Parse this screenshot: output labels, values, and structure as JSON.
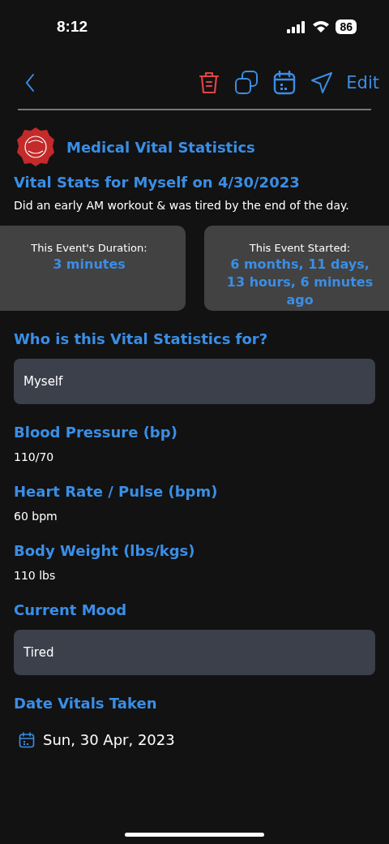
{
  "status_bar": {
    "time": "8:12",
    "battery": "86"
  },
  "toolbar": {
    "edit": "Edit"
  },
  "header": {
    "category": "Medical Vital Statistics",
    "title": "Vital Stats for Myself on 4/30/2023",
    "note": "Did an early AM workout & was tired by the end of the day."
  },
  "cards": [
    {
      "label": "This Event's Duration:",
      "value": "3 minutes"
    },
    {
      "label": "This Event Started:",
      "value": "6 months, 11 days, 13 hours, 6 minutes ago"
    }
  ],
  "fields": [
    {
      "kind": "box",
      "label": "Who is this Vital Statistics for?",
      "value": "Myself"
    },
    {
      "kind": "text",
      "label": "Blood Pressure (bp)",
      "value": "110/70"
    },
    {
      "kind": "text",
      "label": "Heart Rate / Pulse (bpm)",
      "value": "60 bpm"
    },
    {
      "kind": "text",
      "label": "Body Weight (lbs/kgs)",
      "value": "110 lbs"
    },
    {
      "kind": "box",
      "label": "Current Mood",
      "value": "Tired"
    },
    {
      "kind": "date",
      "label": "Date Vitals Taken",
      "value": "Sun, 30 Apr, 2023"
    }
  ]
}
